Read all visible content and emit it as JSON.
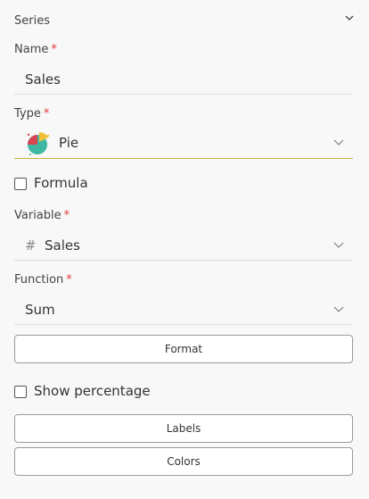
{
  "section": {
    "title": "Series"
  },
  "name": {
    "label": "Name",
    "required": "*",
    "value": "Sales"
  },
  "type": {
    "label": "Type",
    "required": "*",
    "value": "Pie",
    "icon": "pie-chart-icon"
  },
  "formula": {
    "label": "Formula",
    "checked": false
  },
  "variable": {
    "label": "Variable",
    "required": "*",
    "value": "Sales",
    "icon": "hash-icon",
    "icon_glyph": "#"
  },
  "function": {
    "label": "Function",
    "required": "*",
    "value": "Sum"
  },
  "buttons": {
    "format": "Format",
    "labels": "Labels",
    "colors": "Colors"
  },
  "show_percentage": {
    "label": "Show percentage",
    "checked": false
  },
  "colors": {
    "required": "#e53935",
    "active_underline": "#c9b24a",
    "pie_red": "#d64550",
    "pie_yellow": "#f2c037",
    "pie_teal": "#3fb8a3"
  }
}
